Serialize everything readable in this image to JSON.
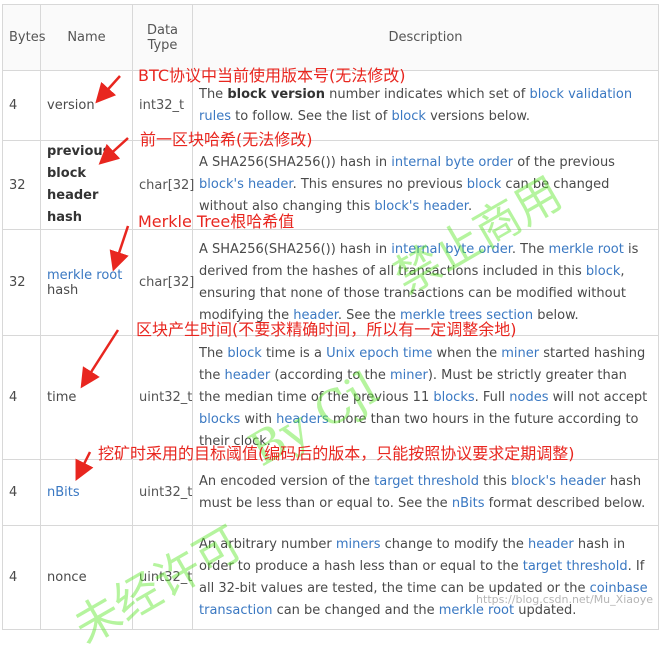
{
  "table": {
    "headers": {
      "bytes": "Bytes",
      "name": "Name",
      "type_line1": "Data",
      "type_line2": "Type",
      "description": "Description"
    },
    "rows": [
      {
        "bytes": "4",
        "name": "version",
        "type": "int32_t",
        "desc": [
          {
            "t": "The "
          },
          {
            "t": "block version",
            "s": "b"
          },
          {
            "t": " number indicates which set of "
          },
          {
            "t": "block validation rules",
            "s": "link"
          },
          {
            "t": " to follow. See the list of "
          },
          {
            "t": "block",
            "s": "link"
          },
          {
            "t": " versions below."
          }
        ]
      },
      {
        "bytes": "32",
        "name_lines": [
          "previous",
          "block",
          "header hash"
        ],
        "type": "char[32]",
        "desc": [
          {
            "t": "A SHA256(SHA256()) hash in "
          },
          {
            "t": "internal byte order",
            "s": "link"
          },
          {
            "t": " of the previous "
          },
          {
            "t": "block's header",
            "s": "link"
          },
          {
            "t": ". This ensures no previous "
          },
          {
            "t": "block",
            "s": "link"
          },
          {
            "t": " can be changed without also changing this "
          },
          {
            "t": "block's header",
            "s": "link"
          },
          {
            "t": "."
          }
        ]
      },
      {
        "bytes": "32",
        "name_parts": [
          "merkle root",
          "hash"
        ],
        "type": "char[32]",
        "desc": [
          {
            "t": "A SHA256(SHA256()) hash in "
          },
          {
            "t": "internal byte order",
            "s": "link"
          },
          {
            "t": ". The "
          },
          {
            "t": "merkle root",
            "s": "link"
          },
          {
            "t": " is derived from the hashes of all transactions included in this "
          },
          {
            "t": "block",
            "s": "link"
          },
          {
            "t": ", ensuring that none of those transactions can be modified without modifying the "
          },
          {
            "t": "header",
            "s": "link"
          },
          {
            "t": ". See the "
          },
          {
            "t": "merkle trees section",
            "s": "link"
          },
          {
            "t": " below."
          }
        ]
      },
      {
        "bytes": "4",
        "name": "time",
        "type": "uint32_t",
        "desc": [
          {
            "t": "The "
          },
          {
            "t": "block",
            "s": "link"
          },
          {
            "t": " time is a "
          },
          {
            "t": "Unix epoch time",
            "s": "link"
          },
          {
            "t": " when the "
          },
          {
            "t": "miner",
            "s": "link"
          },
          {
            "t": " started hashing the "
          },
          {
            "t": "header",
            "s": "link"
          },
          {
            "t": " (according to the "
          },
          {
            "t": "miner",
            "s": "link"
          },
          {
            "t": "). Must be strictly greater than the median time of the previous 11 "
          },
          {
            "t": "blocks",
            "s": "link"
          },
          {
            "t": ". Full "
          },
          {
            "t": "nodes",
            "s": "link"
          },
          {
            "t": " will not accept "
          },
          {
            "t": "blocks",
            "s": "link"
          },
          {
            "t": " with "
          },
          {
            "t": "headers",
            "s": "link"
          },
          {
            "t": " more than two hours in the future according to their clock."
          }
        ]
      },
      {
        "bytes": "4",
        "name": "nBits",
        "type": "uint32_t",
        "desc": [
          {
            "t": "An encoded version of the "
          },
          {
            "t": "target threshold",
            "s": "link"
          },
          {
            "t": " this "
          },
          {
            "t": "block's header",
            "s": "link"
          },
          {
            "t": " hash must be less than or equal to. See the "
          },
          {
            "t": "nBits",
            "s": "link"
          },
          {
            "t": " format described below."
          }
        ]
      },
      {
        "bytes": "4",
        "name": "nonce",
        "type": "uint32_t",
        "desc": [
          {
            "t": "An arbitrary number "
          },
          {
            "t": "miners",
            "s": "link"
          },
          {
            "t": " change to modify the "
          },
          {
            "t": "header",
            "s": "link"
          },
          {
            "t": " hash in order to produce a hash less than or equal to the "
          },
          {
            "t": "target threshold",
            "s": "link"
          },
          {
            "t": ". If all 32-bit values are tested, the time can be updated or the "
          },
          {
            "t": "coinbase transaction",
            "s": "link"
          },
          {
            "t": " can be changed and the "
          },
          {
            "t": "merkle root",
            "s": "link"
          },
          {
            "t": " updated."
          }
        ]
      }
    ]
  },
  "annotations": {
    "version": "BTC协议中当前使用版本号(无法修改)",
    "previous": "前一区块哈希(无法修改)",
    "merkle": "Merkle Tree根哈希值",
    "time": "区块产生时间(不要求精确时间，所以有一定调整余地)",
    "nbits": "挖矿时采用的目标阈值(编码后的版本，只能按照协议要求定期调整)"
  },
  "annotation_color": "#e8261f",
  "link_color": "#3a78c2",
  "watermark": {
    "text1": "未经许可",
    "text2": "By Cjl",
    "text3": "禁止商用",
    "url": "https://blog.csdn.net/Mu_Xiaoye"
  }
}
